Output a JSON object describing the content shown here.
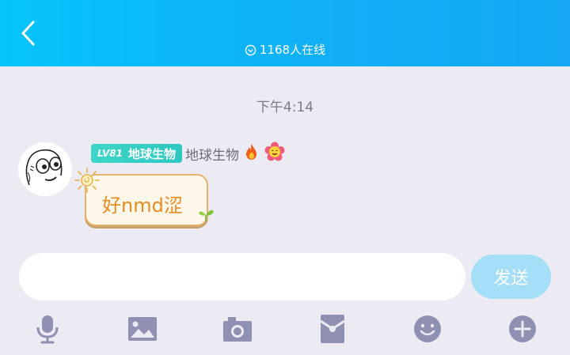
{
  "header": {
    "online_text": "1168人在线",
    "bg_color": "#0fb6f8"
  },
  "chat": {
    "time_label": "下午4:14",
    "message": {
      "level_prefix": "LV81",
      "level_title": "地球生物",
      "nickname": "地球生物",
      "text": "好nmd涩",
      "badges": [
        "fire-icon",
        "flower-emoji-icon"
      ]
    }
  },
  "composer": {
    "input_value": "",
    "send_label": "发送"
  },
  "toolbar": {
    "items": [
      "microphone-icon",
      "image-icon",
      "camera-icon",
      "red-packet-icon",
      "emoji-icon",
      "plus-icon"
    ]
  }
}
